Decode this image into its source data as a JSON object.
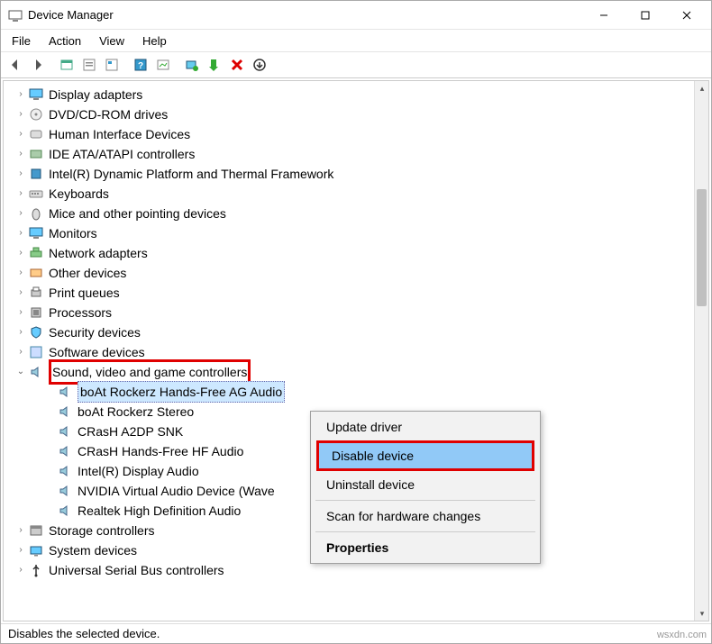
{
  "window": {
    "title": "Device Manager"
  },
  "menubar": [
    "File",
    "Action",
    "View",
    "Help"
  ],
  "toolbar_icons": [
    "back-arrow-icon",
    "forward-arrow-icon",
    "show-hidden-icon",
    "refresh-icon",
    "properties-icon",
    "help-icon",
    "scan-icon",
    "update-driver-icon",
    "install-icon",
    "disable-icon",
    "uninstall-icon"
  ],
  "tree": [
    {
      "label": "Display adapters",
      "icon": "monitor-icon",
      "indent": 0,
      "twisty": "closed"
    },
    {
      "label": "DVD/CD-ROM drives",
      "icon": "disc-icon",
      "indent": 0,
      "twisty": "closed"
    },
    {
      "label": "Human Interface Devices",
      "icon": "hid-icon",
      "indent": 0,
      "twisty": "closed"
    },
    {
      "label": "IDE ATA/ATAPI controllers",
      "icon": "ide-icon",
      "indent": 0,
      "twisty": "closed"
    },
    {
      "label": "Intel(R) Dynamic Platform and Thermal Framework",
      "icon": "chip-icon",
      "indent": 0,
      "twisty": "closed"
    },
    {
      "label": "Keyboards",
      "icon": "keyboard-icon",
      "indent": 0,
      "twisty": "closed"
    },
    {
      "label": "Mice and other pointing devices",
      "icon": "mouse-icon",
      "indent": 0,
      "twisty": "closed"
    },
    {
      "label": "Monitors",
      "icon": "monitor-icon",
      "indent": 0,
      "twisty": "closed"
    },
    {
      "label": "Network adapters",
      "icon": "network-icon",
      "indent": 0,
      "twisty": "closed"
    },
    {
      "label": "Other devices",
      "icon": "other-icon",
      "indent": 0,
      "twisty": "closed"
    },
    {
      "label": "Print queues",
      "icon": "printer-icon",
      "indent": 0,
      "twisty": "closed"
    },
    {
      "label": "Processors",
      "icon": "cpu-icon",
      "indent": 0,
      "twisty": "closed"
    },
    {
      "label": "Security devices",
      "icon": "security-icon",
      "indent": 0,
      "twisty": "closed"
    },
    {
      "label": "Software devices",
      "icon": "software-icon",
      "indent": 0,
      "twisty": "closed"
    },
    {
      "label": "Sound, video and game controllers",
      "icon": "speaker-icon",
      "indent": 0,
      "twisty": "open",
      "highlight": true
    },
    {
      "label": "boAt Rockerz Hands-Free AG Audio",
      "icon": "speaker-icon",
      "indent": 1,
      "twisty": "none",
      "selected": true
    },
    {
      "label": "boAt Rockerz Stereo",
      "icon": "speaker-icon",
      "indent": 1,
      "twisty": "none"
    },
    {
      "label": "CRasH A2DP SNK",
      "icon": "speaker-icon",
      "indent": 1,
      "twisty": "none"
    },
    {
      "label": "CRasH Hands-Free HF Audio",
      "icon": "speaker-icon",
      "indent": 1,
      "twisty": "none"
    },
    {
      "label": "Intel(R) Display Audio",
      "icon": "speaker-icon",
      "indent": 1,
      "twisty": "none"
    },
    {
      "label": "NVIDIA Virtual Audio Device (Wave",
      "icon": "speaker-icon",
      "indent": 1,
      "twisty": "none"
    },
    {
      "label": "Realtek High Definition Audio",
      "icon": "speaker-icon",
      "indent": 1,
      "twisty": "none"
    },
    {
      "label": "Storage controllers",
      "icon": "storage-icon",
      "indent": 0,
      "twisty": "closed"
    },
    {
      "label": "System devices",
      "icon": "system-icon",
      "indent": 0,
      "twisty": "closed"
    },
    {
      "label": "Universal Serial Bus controllers",
      "icon": "usb-icon",
      "indent": 0,
      "twisty": "closed"
    }
  ],
  "context_menu": {
    "items": [
      {
        "label": "Update driver",
        "type": "item"
      },
      {
        "label": "Disable device",
        "type": "item",
        "highlight": true,
        "red": true
      },
      {
        "label": "Uninstall device",
        "type": "item"
      },
      {
        "type": "sep"
      },
      {
        "label": "Scan for hardware changes",
        "type": "item"
      },
      {
        "type": "sep"
      },
      {
        "label": "Properties",
        "type": "item",
        "bold": true
      }
    ]
  },
  "statusbar": "Disables the selected device.",
  "watermark": "wsxdn.com"
}
